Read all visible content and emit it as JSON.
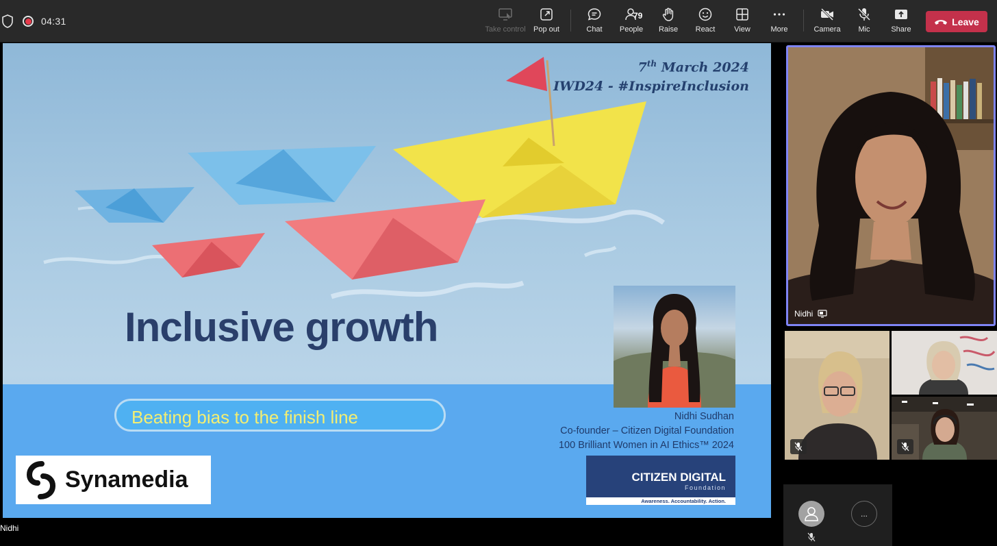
{
  "toolbar": {
    "timer": "04:31",
    "buttons": {
      "take_control": "Take control",
      "pop_out": "Pop out",
      "chat": "Chat",
      "people": "People",
      "people_count": "79",
      "raise": "Raise",
      "react": "React",
      "view": "View",
      "more": "More",
      "camera": "Camera",
      "mic": "Mic",
      "share": "Share",
      "leave": "Leave"
    }
  },
  "slide": {
    "date_day": "7",
    "date_suffix": "th",
    "date_rest": " March 2024",
    "event": "IWD24 - #InspireInclusion",
    "title": "Inclusive growth",
    "subtitle": "Beating bias to the finish line",
    "speaker_name": "Nidhi Sudhan",
    "speaker_role": "Co-founder – Citizen Digital Foundation",
    "speaker_award": "100 Brilliant Women in AI Ethics™ 2024",
    "logo_left": "Synamedia",
    "logo_right_name": "CITIZEN DIGITAL",
    "logo_right_sub": "Foundation",
    "logo_right_tagline": "Awareness. Accountability. Action."
  },
  "sharing_name": "Nidhi",
  "participants": {
    "main_name": "Nidhi"
  },
  "self_view": {
    "more_label": "..."
  },
  "colors": {
    "toolbar_bg": "#292929",
    "leave_red": "#c4314b",
    "speaker_border": "#7f85f5",
    "slide_navy": "#2a3f6b",
    "slide_band": "#5aa9ef",
    "subtitle_yellow": "#f3ee72"
  },
  "icons": [
    "shield-icon",
    "record-icon",
    "take-control-icon",
    "pop-out-icon",
    "chat-icon",
    "people-icon",
    "raise-hand-icon",
    "react-icon",
    "view-icon",
    "more-icon",
    "camera-off-icon",
    "mic-off-icon",
    "share-icon",
    "phone-icon",
    "screen-share-icon",
    "avatar-icon"
  ]
}
